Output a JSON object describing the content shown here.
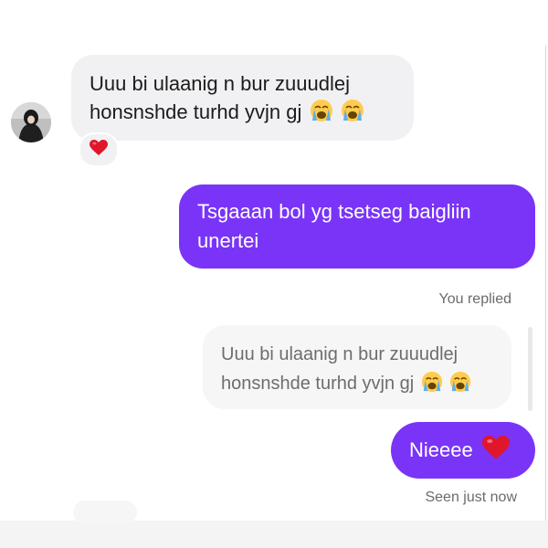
{
  "conversation": {
    "incoming": {
      "line1": "Uuu bi ulaanig n bur zuuudlej",
      "line2": "honsnshde turhd yvjn gj",
      "emoji": "loudly-crying-face",
      "reaction_emoji": "red-heart"
    },
    "outgoing_message": {
      "line1": "Tsgaaan bol yg tsetseg baigliin",
      "line2": "unertei"
    },
    "reply_label": "You replied",
    "quoted_message": {
      "line1": "Uuu bi ulaanig n bur zuuudlej",
      "line2": "honsnshde turhd yvjn gj"
    },
    "reply_message": {
      "text": "Nieeee",
      "emoji": "red-heart"
    },
    "status": "Seen just now"
  },
  "colors": {
    "outgoing_bubble": "#7a34f7",
    "incoming_bubble": "#f1f1f3",
    "meta_text": "#6b6b6b"
  }
}
